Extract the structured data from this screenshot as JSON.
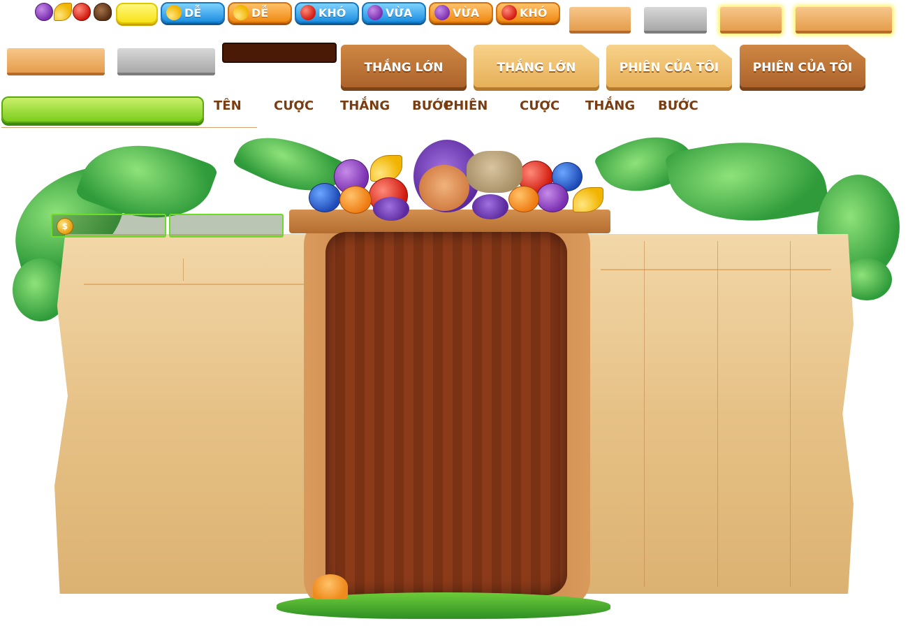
{
  "difficulty_pills": [
    {
      "label": "DỄ",
      "fruit": "banana-icon",
      "style": "blue"
    },
    {
      "label": "DỄ",
      "fruit": "banana-icon",
      "style": "orange"
    },
    {
      "label": "KHÓ",
      "fruit": "apple-icon",
      "style": "blue"
    },
    {
      "label": "VỪA",
      "fruit": "grape-icon",
      "style": "blue"
    },
    {
      "label": "VỪA",
      "fruit": "grape-icon",
      "style": "orange"
    },
    {
      "label": "KHÓ",
      "fruit": "apple-icon",
      "style": "orange"
    }
  ],
  "tabs": [
    {
      "label": "THẮNG LỚN",
      "style": "dark"
    },
    {
      "label": "THẮNG LỚN",
      "style": "light"
    },
    {
      "label": "PHIÊN CỦA TÔI",
      "style": "light"
    },
    {
      "label": "PHIÊN CỦA TÔI",
      "style": "dark"
    }
  ],
  "big_win_headers": [
    "TÊN",
    "CƯỢC",
    "THẮNG",
    "BƯỚC"
  ],
  "my_session_headers": [
    "PHIÊN",
    "CƯỢC",
    "THẮNG",
    "BƯỚC"
  ],
  "balance_coin_symbol": "$",
  "colors": {
    "accent_green": "#6bdc27",
    "wood": "#8b3b1a",
    "paper": "#e6c186"
  }
}
